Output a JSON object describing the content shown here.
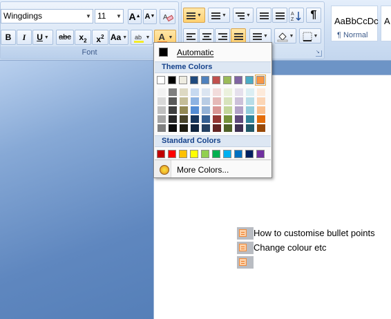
{
  "font_group": {
    "label": "Font",
    "font_name": "Wingdings",
    "font_size": "11",
    "buttons": {
      "grow_font": "A",
      "shrink_font": "A",
      "bold": "B",
      "italic": "I",
      "underline": "U",
      "strikethrough": "abc",
      "subscript": "x",
      "subscript_mark": "2",
      "superscript": "x",
      "superscript_mark": "2",
      "change_case": "Aa",
      "font_color": "A"
    },
    "highlight_color": "#f4ec28",
    "font_color_bar": "#f07a20"
  },
  "paragraph_group": {
    "show_marks": "¶"
  },
  "styles": [
    {
      "sample": "AaBbCcDc",
      "name": "¶ Normal"
    },
    {
      "sample": "A",
      "name": ""
    }
  ],
  "document": {
    "bullets": [
      {
        "text": "How to customise bullet points"
      },
      {
        "text": "Change colour etc"
      },
      {
        "text": ""
      }
    ],
    "bullet_color": "#f07a20"
  },
  "color_menu": {
    "automatic_label": "Automatic",
    "theme_heading": "Theme Colors",
    "standard_heading": "Standard Colors",
    "more_colors_label": "More Colors...",
    "theme_base": [
      "#ffffff",
      "#000000",
      "#eeece1",
      "#1f497d",
      "#4f81bd",
      "#c0504d",
      "#9bbb59",
      "#8064a2",
      "#4bacc6",
      "#f79646"
    ],
    "theme_shades": [
      [
        "#f2f2f2",
        "#d8d8d8",
        "#bfbfbf",
        "#a5a5a5",
        "#7f7f7f"
      ],
      [
        "#7f7f7f",
        "#595959",
        "#3f3f3f",
        "#262626",
        "#0c0c0c"
      ],
      [
        "#ddd9c3",
        "#c4bd97",
        "#938953",
        "#494429",
        "#1d1b10"
      ],
      [
        "#c6d9f0",
        "#8db3e2",
        "#548dd4",
        "#17365d",
        "#0f243e"
      ],
      [
        "#dbe5f1",
        "#b8cce4",
        "#95b3d7",
        "#366092",
        "#244061"
      ],
      [
        "#f2dcdb",
        "#e5b9b7",
        "#d99694",
        "#953734",
        "#632423"
      ],
      [
        "#ebf1dd",
        "#d7e3bc",
        "#c3d69b",
        "#76923c",
        "#4f6128"
      ],
      [
        "#e5e0ec",
        "#ccc1d9",
        "#b2a2c7",
        "#5f497a",
        "#3f3151"
      ],
      [
        "#dbeef3",
        "#b7dde8",
        "#92cddc",
        "#31859b",
        "#205867"
      ],
      [
        "#fdeada",
        "#fbd5b5",
        "#fac08f",
        "#e36c09",
        "#974806"
      ]
    ],
    "standard": [
      "#c00000",
      "#ff0000",
      "#ffc000",
      "#ffff00",
      "#92d050",
      "#00b050",
      "#00b0f0",
      "#0070c0",
      "#002060",
      "#7030a0"
    ],
    "selected_theme_index": 9
  }
}
